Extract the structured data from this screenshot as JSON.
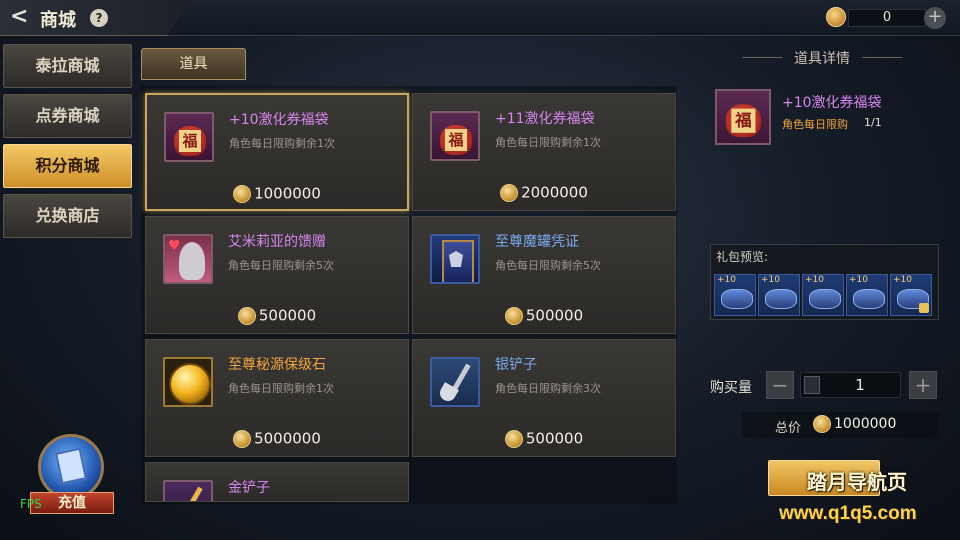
{
  "header": {
    "back_icon": "back-arrow-icon",
    "title": "商城",
    "help_icon": "question-icon",
    "currency_value": "0",
    "plus_label": "+"
  },
  "nav": {
    "items": [
      {
        "label": "泰拉商城",
        "active": false
      },
      {
        "label": "点券商城",
        "active": false
      },
      {
        "label": "积分商城",
        "active": true
      },
      {
        "label": "兑换商店",
        "active": false
      }
    ]
  },
  "tab": {
    "label": "道具"
  },
  "items": [
    {
      "name": "+10激化券福袋",
      "limit": "角色每日限购剩余1次",
      "price": "1000000",
      "name_color": "#d985ef",
      "icon": "lucky-bag-icon"
    },
    {
      "name": "+11激化券福袋",
      "limit": "角色每日限购剩余1次",
      "price": "2000000",
      "name_color": "#d985ef",
      "icon": "lucky-bag-icon"
    },
    {
      "name": "艾米莉亚的馈赠",
      "limit": "角色每日限购剩余5次",
      "price": "500000",
      "name_color": "#d985ef",
      "icon": "character-portrait-icon"
    },
    {
      "name": "至尊魔罐凭证",
      "limit": "角色每日限购剩余5次",
      "price": "500000",
      "name_color": "#7aa9f0",
      "icon": "magic-card-icon"
    },
    {
      "name": "至尊秘源保级石",
      "limit": "角色每日限购剩余1次",
      "price": "5000000",
      "name_color": "#f2a43d",
      "icon": "golden-orb-icon"
    },
    {
      "name": "银铲子",
      "limit": "角色每日限购剩余3次",
      "price": "500000",
      "name_color": "#7aa9f0",
      "icon": "silver-shovel-icon"
    },
    {
      "name": "金铲子",
      "limit": "",
      "price": "",
      "name_color": "#d985ef",
      "icon": "gold-shovel-icon"
    }
  ],
  "detail": {
    "title": "道具详情",
    "name": "+10激化券福袋",
    "limit_label": "角色每日限购",
    "count": "1/1",
    "preview_label": "礼包预览:",
    "preview_items": [
      "+10",
      "+10",
      "+10",
      "+10",
      "+10"
    ],
    "qty_label": "购买量",
    "qty_value": "1",
    "minus_label": "−",
    "plus_label": "+",
    "total_label": "总价",
    "total_price": "1000000"
  },
  "recharge": {
    "label": "充值"
  },
  "fps": "FPS",
  "watermark": {
    "line1": "踏月导航页",
    "line2": "www.q1q5.com"
  }
}
